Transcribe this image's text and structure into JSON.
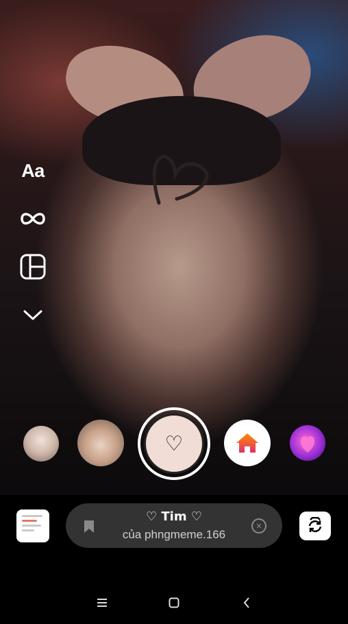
{
  "tools": {
    "text_label": "Aa",
    "items": [
      "text-tool",
      "boomerang-tool",
      "layout-tool",
      "more-tools"
    ]
  },
  "effects": {
    "selected_name": "♡ Tim ♡",
    "selected_creator": "của phngmeme.166",
    "capture_glyph": "♡",
    "clear_glyph": "✕"
  },
  "colors": {
    "pill": "#333333",
    "capture_fill": "#f2ddd6",
    "home_gradient_start": "#ff8a00",
    "home_gradient_end": "#e1306c"
  }
}
